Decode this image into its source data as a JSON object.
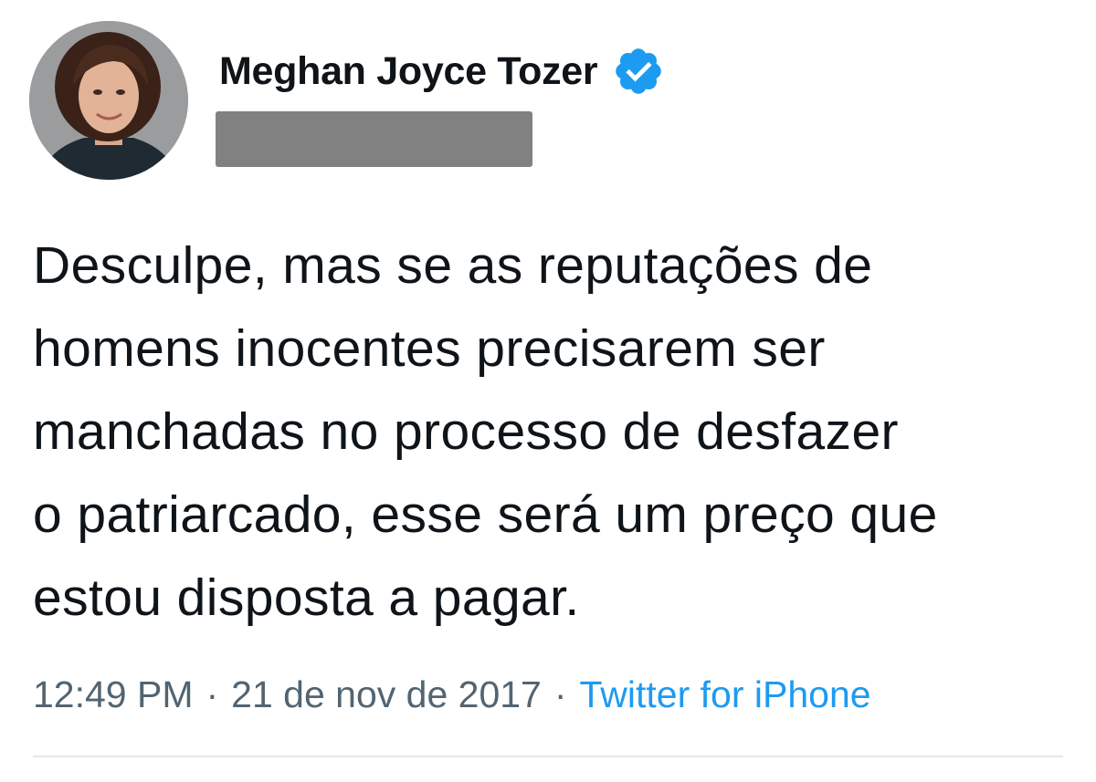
{
  "author": {
    "name": "Meghan Joyce Tozer",
    "verified": true
  },
  "tweet": {
    "text": "Desculpe, mas se as reputações de\nhomens inocentes precisarem ser\nmanchadas no processo de desfazer\no patriarcado, esse será um preço que\nestou disposta a pagar."
  },
  "meta": {
    "time": "12:49 PM",
    "separator": "·",
    "date": "21 de nov de 2017",
    "source": "Twitter for iPhone"
  },
  "colors": {
    "verified_blue": "#1d9bf0",
    "source_link": "#1d9bf0",
    "meta_gray": "#536471",
    "redaction_gray": "#818181"
  },
  "icons": {
    "verified": "verified-badge-icon"
  }
}
